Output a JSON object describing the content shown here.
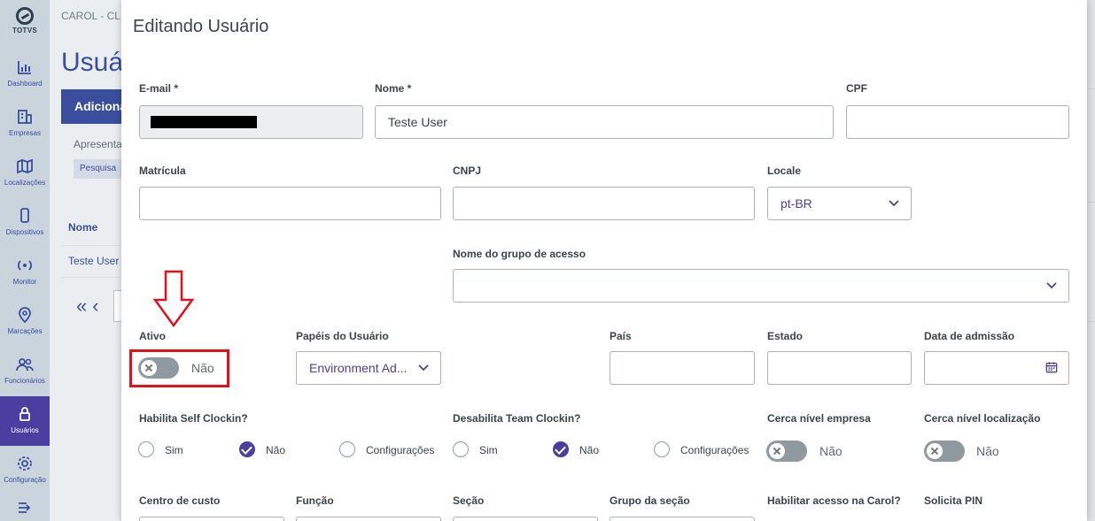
{
  "sidebar": {
    "logo_text": "TOTVS",
    "items": [
      {
        "label": "Dashboard",
        "icon": "bar-chart-icon"
      },
      {
        "label": "Empresas",
        "icon": "building-icon"
      },
      {
        "label": "Localizações",
        "icon": "map-icon"
      },
      {
        "label": "Dispositivos",
        "icon": "phone-icon"
      },
      {
        "label": "Monitor",
        "icon": "broadcast-icon"
      },
      {
        "label": "Marcações",
        "icon": "location-pin-icon"
      },
      {
        "label": "Funcionários",
        "icon": "users-icon"
      },
      {
        "label": "Usuários",
        "icon": "lock-icon"
      },
      {
        "label": "Configuração",
        "icon": "gear-icon"
      }
    ],
    "expand_icon": "expand-icon"
  },
  "background": {
    "breadcrumb": "CAROL - CL",
    "title": "Usuá",
    "add_button": "Adiciona",
    "present_label": "Apresentar",
    "search_chip": "Pesquisa",
    "table_header": "Nome",
    "table_row": "Teste User"
  },
  "modal": {
    "title": "Editando Usuário",
    "email": {
      "label": "E-mail *",
      "value": ""
    },
    "nome": {
      "label": "Nome *",
      "value": "Teste User"
    },
    "cpf": {
      "label": "CPF",
      "value": ""
    },
    "matricula": {
      "label": "Matrícula",
      "value": ""
    },
    "cnpj": {
      "label": "CNPJ",
      "value": ""
    },
    "locale": {
      "label": "Locale",
      "value": "pt-BR"
    },
    "grupo_acesso": {
      "label": "Nome do grupo de acesso",
      "value": ""
    },
    "ativo": {
      "label": "Ativo",
      "toggle_text": "Não"
    },
    "papeis": {
      "label": "Papéis do Usuário",
      "value": "Environment Ad..."
    },
    "pais": {
      "label": "País",
      "value": ""
    },
    "estado": {
      "label": "Estado",
      "value": ""
    },
    "data_admissao": {
      "label": "Data de admissão",
      "value": ""
    },
    "self_clockin": {
      "label": "Habilita Self Clockin?",
      "options": [
        "Sim",
        "Não",
        "Configurações"
      ],
      "selected": "Não"
    },
    "team_clockin": {
      "label": "Desabilita Team Clockin?",
      "options": [
        "Sim",
        "Não",
        "Configurações"
      ],
      "selected": "Não"
    },
    "cerca_empresa": {
      "label": "Cerca nível empresa",
      "toggle_text": "Não"
    },
    "cerca_localizacao": {
      "label": "Cerca nível localização",
      "toggle_text": "Não"
    },
    "centro_custo": {
      "label": "Centro de custo"
    },
    "funcao": {
      "label": "Função"
    },
    "secao": {
      "label": "Seção"
    },
    "grupo_secao": {
      "label": "Grupo da seção"
    },
    "acesso_carol": {
      "label": "Habilitar acesso na Carol?"
    },
    "solicita_pin": {
      "label": "Solicita PIN"
    }
  },
  "colors": {
    "primary": "#3a4e9e",
    "accent_purple": "#4a3fa0",
    "annotation_red": "#e0111b",
    "sidebar_bg": "#c9d4dc"
  }
}
